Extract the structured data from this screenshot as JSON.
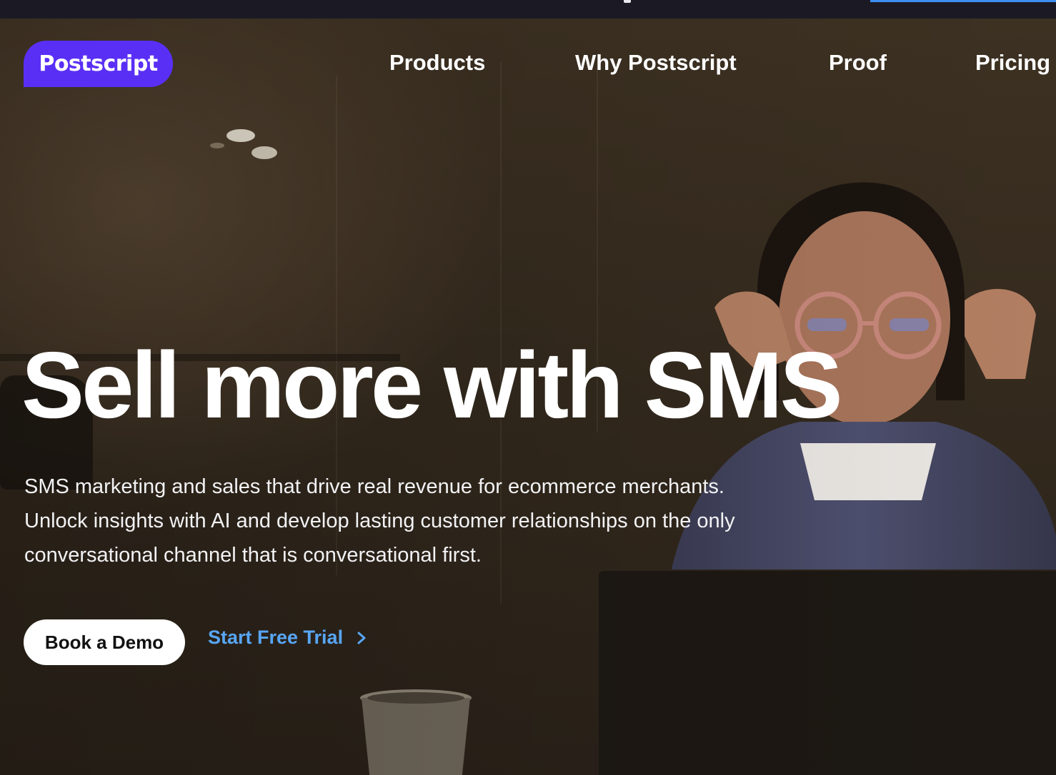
{
  "brand": {
    "name": "Postscript",
    "color": "#5a2ff5"
  },
  "nav": {
    "links": [
      {
        "label": "Products"
      },
      {
        "label": "Why Postscript"
      },
      {
        "label": "Proof"
      },
      {
        "label": "Pricing"
      }
    ]
  },
  "hero": {
    "headline": "Sell more with SMS",
    "subtext_lines": [
      "SMS marketing and sales that drive real revenue for ecommerce merchants.",
      "Unlock insights with AI and develop lasting customer relationships on the only",
      "conversational channel that is conversational first."
    ],
    "primary_cta": "Book a Demo",
    "secondary_cta": "Start Free Trial",
    "secondary_cta_icon": "chevron-right-icon",
    "secondary_cta_color": "#58a6f5"
  },
  "colors": {
    "topbar": "#1b1a24",
    "topbar_accent": "#3d8ef0",
    "cta_bg": "#ffffff"
  }
}
